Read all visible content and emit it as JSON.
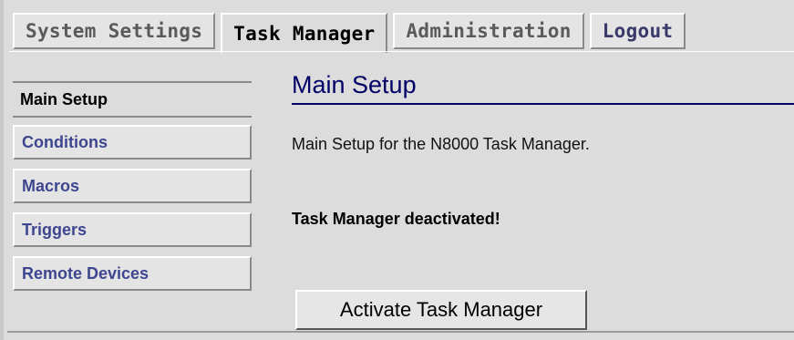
{
  "tabs": [
    {
      "label": "System Settings"
    },
    {
      "label": "Task Manager"
    },
    {
      "label": "Administration"
    },
    {
      "label": "Logout"
    }
  ],
  "sidebar": {
    "items": [
      {
        "label": "Main Setup"
      },
      {
        "label": "Conditions"
      },
      {
        "label": "Macros"
      },
      {
        "label": "Triggers"
      },
      {
        "label": "Remote Devices"
      }
    ]
  },
  "main": {
    "title": "Main Setup",
    "description": "Main Setup for the N8000 Task Manager.",
    "status": "Task Manager deactivated!",
    "button_label": "Activate Task Manager"
  },
  "colors": {
    "background": "#dcdcdc",
    "link": "#3e4690",
    "title": "#000066"
  }
}
